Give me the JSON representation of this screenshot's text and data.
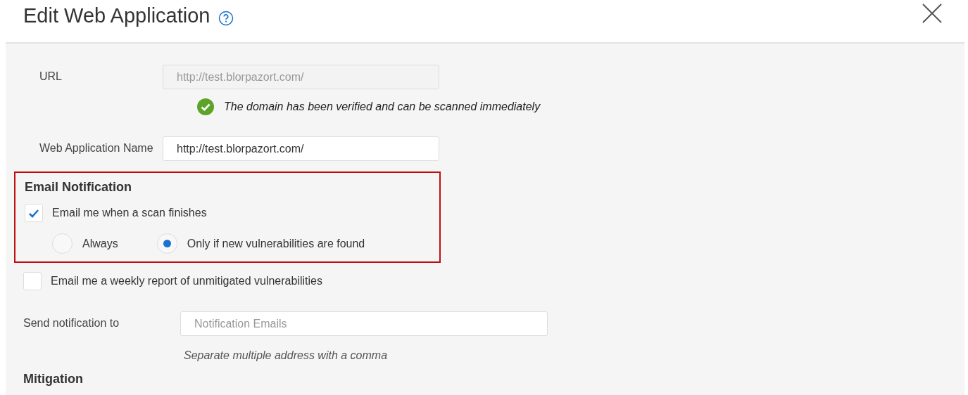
{
  "dialog": {
    "title": "Edit Web Application"
  },
  "url": {
    "label": "URL",
    "value": "http://test.blorpazort.com/",
    "disabled": true,
    "verified_message": "The domain has been verified and can be scanned immediately"
  },
  "name": {
    "label": "Web Application Name",
    "value": "http://test.blorpazort.com/"
  },
  "email_notification": {
    "heading": "Email Notification",
    "highlighted": true,
    "scan_finish": {
      "label": "Email me when a scan finishes",
      "checked": true
    },
    "options": [
      {
        "label": "Always",
        "selected": false
      },
      {
        "label": "Only if new vulnerabilities are found",
        "selected": true
      }
    ]
  },
  "weekly_report": {
    "label": "Email me a weekly report of unmitigated vulnerabilities",
    "checked": false
  },
  "send_to": {
    "label": "Send notification to",
    "placeholder": "Notification Emails",
    "hint": "Separate multiple address with a comma"
  },
  "next_section": {
    "heading": "Mitigation"
  }
}
